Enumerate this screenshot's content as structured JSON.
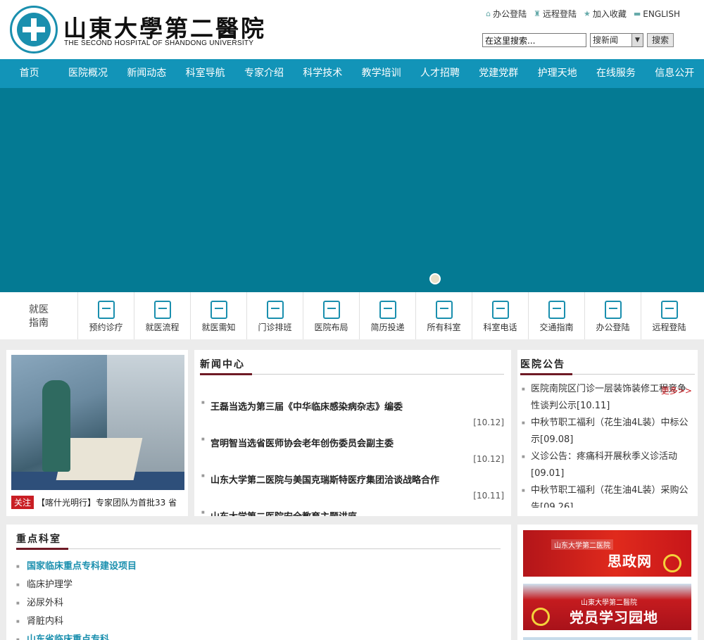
{
  "header": {
    "title_cn": "山東大學第二醫院",
    "title_en": "THE SECOND HOSPITAL OF SHANDONG UNIVERSITY",
    "links": [
      {
        "label": "办公登陆",
        "icon": "home-icon"
      },
      {
        "label": "远程登陆",
        "icon": "remote-icon"
      },
      {
        "label": "加入收藏",
        "icon": "star-icon"
      },
      {
        "label": "ENGLISH",
        "icon": "folder-icon"
      }
    ],
    "search": {
      "value": "在这里搜索...",
      "select_value": "搜新闻",
      "button": "搜索"
    }
  },
  "nav": [
    "首页",
    "医院概况",
    "新闻动态",
    "科室导航",
    "专家介绍",
    "科学技术",
    "教学培训",
    "人才招聘",
    "党建党群",
    "护理天地",
    "在线服务",
    "信息公开"
  ],
  "guide": {
    "title_line1": "就医",
    "title_line2": "指南",
    "items": [
      {
        "label": "预约诊疗",
        "icon": "bookmark-plus-icon"
      },
      {
        "label": "就医流程",
        "icon": "exchange-arrows-icon"
      },
      {
        "label": "就医需知",
        "icon": "card-icon"
      },
      {
        "label": "门诊排班",
        "icon": "id-badge-icon"
      },
      {
        "label": "医院布局",
        "icon": "map-icon"
      },
      {
        "label": "简历投递",
        "icon": "person-search-icon"
      },
      {
        "label": "所有科室",
        "icon": "database-icon"
      },
      {
        "label": "科室电话",
        "icon": "chart-area-icon"
      },
      {
        "label": "交通指南",
        "icon": "shuffle-icon"
      },
      {
        "label": "办公登陆",
        "icon": "monitor-icon"
      },
      {
        "label": "远程登陆",
        "icon": "globe-ball-icon"
      }
    ]
  },
  "photo_caption": {
    "tag": "关注",
    "text": "【喀什光明行】专家团队为首批33 省"
  },
  "news": {
    "title": "新闻中心",
    "items": [
      {
        "title": "王磊当选为第三届《中华临床感染病杂志》编委",
        "date": "[10.12]"
      },
      {
        "title": "宫明智当选省医师协会老年创伤委员会副主委",
        "date": "[10.12]"
      },
      {
        "title": "山东大学第二医院与美国克瑞斯特医疗集团洽谈战略合作",
        "date": "[10.11]"
      },
      {
        "title": "山东大学第二医院安全教育主题讲座",
        "date": ""
      }
    ]
  },
  "notices": {
    "title": "医院公告",
    "more": "更多>>",
    "items": [
      "医院南院区门诊一层装饰装修工程竞争性谈判公示[10.11]",
      "中秋节职工福利（花生油4L装）中标公示[09.08]",
      "义诊公告：疼痛科开展秋季义诊活动[09.01]",
      "中秋节职工福利（花生油4L装）采购公告[09.26]"
    ]
  },
  "key_depts": {
    "title": "重点科室",
    "items": [
      {
        "label": "国家临床重点专科建设项目",
        "highlight": true
      },
      {
        "label": "临床护理学",
        "highlight": false
      },
      {
        "label": "泌尿外科",
        "highlight": false
      },
      {
        "label": "肾脏内科",
        "highlight": false
      },
      {
        "label": "山东省临床重点专科",
        "highlight": true
      }
    ]
  },
  "side_banners": [
    {
      "small": "山东大学第二医院",
      "big": "思政网"
    },
    {
      "small": "山東大學第二醫院",
      "big": "党员学习园地"
    }
  ],
  "colors": {
    "nav_bg": "#1294b8",
    "banner_bg": "#047a93",
    "accent_red": "#c91e24",
    "title_underline": "#6e1a25"
  }
}
